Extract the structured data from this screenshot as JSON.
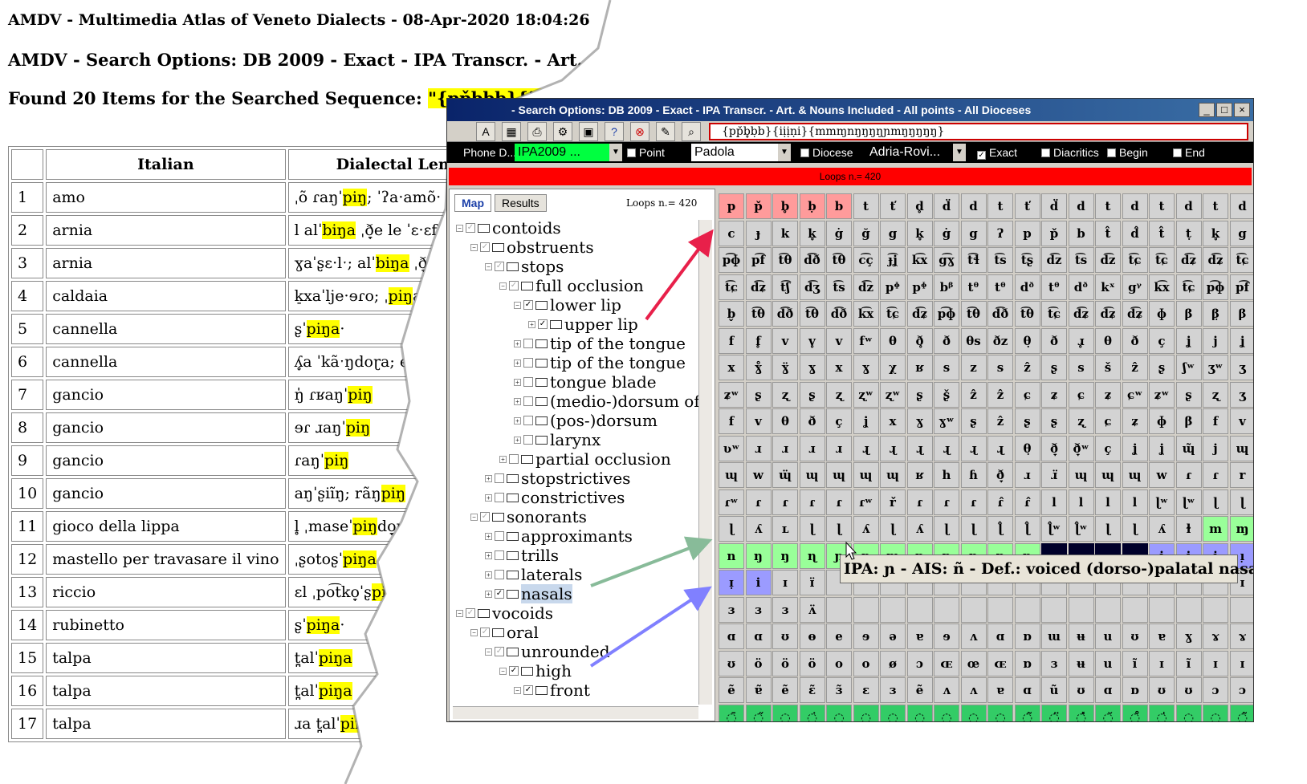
{
  "report": {
    "title": "AMDV - Multimedia Atlas of Veneto Dialects - 08-Apr-2020 18:04:26",
    "options": "AMDV - Search Options: DB 2009 - Exact - IPA Transcr. - Art. & Nouns",
    "found_prefix": "Found 20 Items for the Searched Sequence: ",
    "found_sequence": "\"{pp̌b̥ḅb}{iịịṇi}{mm",
    "table": {
      "headers": [
        "",
        "Italian",
        "Dialectal Lemma"
      ],
      "rows": [
        {
          "n": "1",
          "italian": "amo",
          "pre": "ˌõ ɾaŋˈ",
          "hl": "piŋ",
          "post": "; ˈʔa·amõ·"
        },
        {
          "n": "2",
          "italian": "arnia",
          "pre": "l alˈ",
          "hl": "biŋa",
          "post": " ˌð̞e le ˈɛ·ɛf:"
        },
        {
          "n": "3",
          "italian": "arnia",
          "pre": "ɣaˈʂɛ·lˑ; alˈ",
          "hl": "biŋa",
          "post": " ˌð̞e lə ˈaf"
        },
        {
          "n": "4",
          "italian": "caldaia",
          "pre": "k̠xaˈlje·ɘɾo; ˌ",
          "hl": "piŋ",
          "post": "aˈt̪õŋ"
        },
        {
          "n": "5",
          "italian": "cannella",
          "pre": "ʂˈ",
          "hl": "piŋa",
          "post": "·"
        },
        {
          "n": "6",
          "italian": "cannella",
          "pre": "ʎ̥a ˈkãˑŋdoɽa; el ˌkaŋdoˈiŋ; a",
          "hl": "",
          "post": ""
        },
        {
          "n": "7",
          "italian": "gancio",
          "pre": "ŋ̍ ɾʁaŋˈ",
          "hl": "piŋ",
          "post": ""
        },
        {
          "n": "8",
          "italian": "gancio",
          "pre": "ɘɾ ɹaŋˈ",
          "hl": "piŋ",
          "post": ""
        },
        {
          "n": "9",
          "italian": "gancio",
          "pre": "ɾaŋˈ",
          "hl": "piŋ",
          "post": ""
        },
        {
          "n": "10",
          "italian": "gancio",
          "pre": "aŋˈʂiĩŋ; rãŋ",
          "hl": "piŋ",
          "post": ""
        },
        {
          "n": "11",
          "italian": "gioco della lippa",
          "pre": "l̥ ˌmaseˈ",
          "hl": "piŋ",
          "post": "do̞ɽɔ"
        },
        {
          "n": "12",
          "italian": "mastello per travasare il vino",
          "pre": "ˌʂotoʂˈ",
          "hl": "piŋa",
          "post": ""
        },
        {
          "n": "13",
          "italian": "riccio",
          "pre": "ɛl ˌpo͡tko̞ˈʂ",
          "hl": "piŋ",
          "post": ""
        },
        {
          "n": "14",
          "italian": "rubinetto",
          "pre": "ʂˈ",
          "hl": "piŋa",
          "post": "·"
        },
        {
          "n": "15",
          "italian": "talpa",
          "pre": "t̪alˈ",
          "hl": "piŋa",
          "post": ""
        },
        {
          "n": "16",
          "italian": "talpa",
          "pre": "t̪alˈ",
          "hl": "piŋa",
          "post": ""
        },
        {
          "n": "17",
          "italian": "talpa",
          "pre": "ɹa t̪alˈ",
          "hl": "pina",
          "post": ""
        }
      ]
    }
  },
  "app": {
    "window_title": "- Search Options: DB 2009 - Exact - IPA Transcr. - Art. & Nouns Included - All points - All Dioceses",
    "win_buttons": [
      "_",
      "□",
      "×"
    ],
    "search_text": "{pp̌b̥ḅb}{iịịṇi}{mmɱnŋŋŋŋɲmŋŋŋŋŋ}",
    "options": {
      "phone_label": "Phone D...",
      "phone_value": "IPA2009 ...",
      "point_label": "Point",
      "point_value": "Padola",
      "diocese_label": "Diocese",
      "diocese_value": "Adria-Rovi...",
      "exact_label": "Exact",
      "diacritics_label": "Diacritics",
      "begin_label": "Begin",
      "end_label": "End"
    },
    "loops_bar": "Loops n.= 420",
    "tabs": [
      "Map",
      "Results"
    ],
    "loops_left": "Loops n.= 420",
    "tree": [
      {
        "label": "contoids",
        "level": 0,
        "exp": "−",
        "cb": "grey"
      },
      {
        "label": "obstruents",
        "level": 1,
        "exp": "−",
        "cb": "grey"
      },
      {
        "label": "stops",
        "level": 2,
        "exp": "−",
        "cb": "grey"
      },
      {
        "label": "full occlusion",
        "level": 3,
        "exp": "−",
        "cb": "grey"
      },
      {
        "label": "lower lip",
        "level": 4,
        "exp": "−",
        "cb": "check"
      },
      {
        "label": "upper lip",
        "level": 5,
        "exp": "+",
        "cb": "check"
      },
      {
        "label": "tip of the tongue",
        "level": 4,
        "exp": "+",
        "cb": "empty"
      },
      {
        "label": "tip of the tongue",
        "level": 4,
        "exp": "+",
        "cb": "empty"
      },
      {
        "label": "tongue blade",
        "level": 4,
        "exp": "+",
        "cb": "empty"
      },
      {
        "label": "(medio-)dorsum of",
        "level": 4,
        "exp": "+",
        "cb": "empty"
      },
      {
        "label": "(pos-)dorsum",
        "level": 4,
        "exp": "+",
        "cb": "empty"
      },
      {
        "label": "larynx",
        "level": 4,
        "exp": "+",
        "cb": "empty"
      },
      {
        "label": "partial occlusion",
        "level": 3,
        "exp": "+",
        "cb": "empty"
      },
      {
        "label": "stopstrictives",
        "level": 2,
        "exp": "+",
        "cb": "empty"
      },
      {
        "label": "constrictives",
        "level": 2,
        "exp": "+",
        "cb": "empty"
      },
      {
        "label": "sonorants",
        "level": 1,
        "exp": "−",
        "cb": "grey"
      },
      {
        "label": "approximants",
        "level": 2,
        "exp": "+",
        "cb": "empty"
      },
      {
        "label": "trills",
        "level": 2,
        "exp": "+",
        "cb": "empty"
      },
      {
        "label": "laterals",
        "level": 2,
        "exp": "+",
        "cb": "empty"
      },
      {
        "label": "nasals",
        "level": 2,
        "exp": "+",
        "cb": "check",
        "selected": true
      },
      {
        "label": "vocoids",
        "level": 0,
        "exp": "−",
        "cb": "grey"
      },
      {
        "label": "oral",
        "level": 1,
        "exp": "−",
        "cb": "grey"
      },
      {
        "label": "unrounded",
        "level": 2,
        "exp": "−",
        "cb": "grey"
      },
      {
        "label": "high",
        "level": 3,
        "exp": "−",
        "cb": "check"
      },
      {
        "label": "front",
        "level": 4,
        "exp": "−",
        "cb": "check"
      }
    ],
    "tooltip": "IPA: ɲ - AIS: ñ - Def.: voiced (dorso-)palatal nasal",
    "grid": {
      "rows": [
        "p p̌ b̥ ḅ b t t̕ d̥ d̈ d t t̕ d̈ d t d t d t d",
        "c ɟ k k̥ ġ ğ g k̥ ġ g ʔ p p̌ b t̂ d̂ t̂ ṭ k̥ g",
        "p͡ɸ p͡f t͡θ d͡ð t͡θ c͡ç ɟ͡ʝ k͡x g͡ɣ t͡ɬ t͡s t͡ʂ d͡z t͡s d͡z t͡ɕ t͡ɕ d͡ʑ d͡ʑ t͡ɕ",
        "t͡ɕ d͡ʑ t͡ʃ d͡ʒ t͡s d͡z pᶲ pᶲ bᵝ tᶿ tᶿ dᶞ tᶿ dᶞ kˣ gᵞ k͡x t͡ɕ p͡ɸ p͡f",
        "b̬ t͡θ d͡ð t͡θ d͡ð k͡x t͡ɕ d͡ʑ p͡ɸ t͡θ d͡ð t͡θ t͡ɕ d͡ʑ d͡ʑ d͡ʑ ɸ β β̣ β",
        "f f̥ v v̥ v fʷ θ ð̥ ð θs ðz θ̣ ð ɹ̥ θ ð ç ʝ j ʝ",
        "x ɣ̊ ɣ̈ ɣ x ɣ χ ʁ s z s ẑ ʂ s š ẑ ʂ ʃʷ ʒʷ ʒ",
        "ʑʷ ʂ ʐ ʂ ʐ ʐʷ ʐʷ ʂ ʂ̌ ẑ ẑ ɕ ʑ ɕ ʑ ɕʷ ʑʷ ʂ ʐ ʒ",
        "f v θ ð ç ʝ x ɣ ɣʷ ʂ ẑ ʂ ʂ ʐ ɕ ʑ ɸ β f v",
        "ʋʷ ɹ ɹ ɹ ɹ ɻ ɻ ɻ ɻ ɻ ɻ θ̣ ð̞ ð̞ʷ ç ʝ ʝ ɰ̃ j ɰ",
        "ɰ w ɰ̈ ɰ ɰ ɰ ɰ ʁ h ɦ ð̞ ɹ ɹ̈ ɰ ɰ ɰ w ɾ ɾ r",
        "ɾʷ ɾ ɾ ɾ ɾ ɾʷ ř ɾ ɾ ɾ ɾ̂ ɾ̂ l l l l ɭʷ ɭʷ ɭ ɭ",
        "ɭ ʎ ʟ ɭ ɭ ʎ ɭ ʎ ɭ ɭ ɭ̂ ɭ̂ ɭ̂ʷ ɭ̂ʷ ɭ ɭ ʎ ɫ m ɱ",
        "n ŋ ŋ ɳ ɲ ŋ ɱ ŋ ŋ ŋ ɲ ŋ _ _ _ _ i ị ị ı̣",
        "ɪ̣ i ɪ ɪ̈ _ _ _ _ _ _ _ _ _ _ _ _ _ _ _ ɪ",
        "ɜ ɜ ɜ ʌ̈ _ _ _ _ _ _ _ _ _ _ _ _ _ _ _ _",
        "ɑ ɑ ʊ ɵ e ɘ ə ɐ ɘ ʌ ɑ ɒ ɯ ʉ u ʊ ɐ ɣ ɤ ɤ",
        "ʊ ö ö ö o o ø ɔ ɶ œ ɶ ɒ ɜ ʉ u ĩ ɪ ĩ ɪ ɪ",
        "ẽ ɐ̃ ẽ ɛ̃ ɜ̃ ɛ ɜ ẽ ʌ ʌ ɐ ɑ ũ ʊ ɑ ɒ ʊ ʊ ɔ ɔ",
        "◌̄ ◌̋ ◌̣ ◌̇ ◌̤ ◌̥ ◌̬ ◌̹ ◌̜ ◌̟ ◌̠ ◌̃ ◌̈ ◌̽ ◌̆ ◌̊ ◌̍ ◌̩ ◌̯ ◌̃",
        "◌̣ ◌̆ ◌̌ ◌̂ ◌̑ ◌̇ ◌̈ ◌̌ ◌̆ ◌̊ ◌̍"
      ]
    }
  }
}
